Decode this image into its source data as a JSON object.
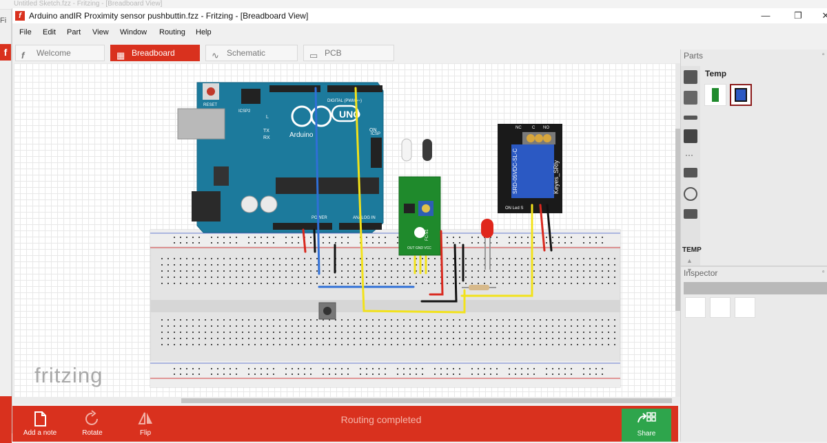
{
  "background_window": {
    "title": "Untitled Sketch.fzz - Fritzing - [Breadboard View]",
    "menu_hint": "Fi"
  },
  "window": {
    "title": "Arduino andIR Proximity sensor  pushbuttin.fzz - Fritzing - [Breadboard View]",
    "controls": {
      "minimize": "—",
      "restore": "❐",
      "close": "✕"
    }
  },
  "menu": [
    "File",
    "Edit",
    "Part",
    "View",
    "Window",
    "Routing",
    "Help"
  ],
  "tabs": [
    {
      "label": "Welcome",
      "icon": "fritzing-f-icon",
      "active": false
    },
    {
      "label": "Breadboard",
      "icon": "breadboard-icon",
      "active": true
    },
    {
      "label": "Schematic",
      "icon": "schematic-icon",
      "active": false
    },
    {
      "label": "PCB",
      "icon": "pcb-icon",
      "active": false
    }
  ],
  "canvas": {
    "watermark": "fritzing",
    "arduino": {
      "brand": "Arduino",
      "model": "UNO",
      "reset": "RESET",
      "icsp": "ICSP2",
      "icsp2": "ICSP",
      "digital": "DIGITAL (PWM=~)",
      "power": "POWER",
      "analog": "ANALOG IN",
      "on": "ON",
      "tx": "TX",
      "rx": "RX",
      "l": "L"
    },
    "ir_sensor": {
      "pins": "OUT GND VCC",
      "model": "FC-51"
    },
    "relay": {
      "terminals": [
        "NC",
        "C",
        "NO"
      ],
      "model": "SRD-05VDC-SL-C",
      "brand": "Keyes_SRly",
      "footer": "ON Led S"
    }
  },
  "toolbar": {
    "add_note": "Add a note",
    "rotate": "Rotate",
    "flip": "Flip",
    "status": "Routing completed",
    "share": "Share"
  },
  "parts_panel": {
    "title": "Parts",
    "bin_label": "TEMP",
    "temp_title": "Temp"
  },
  "inspector_panel": {
    "title": "Inspector"
  },
  "colors": {
    "accent": "#d9311e",
    "share": "#2ea54c",
    "board": "#1c7a9c",
    "breadboard": "#e4e4e4"
  }
}
